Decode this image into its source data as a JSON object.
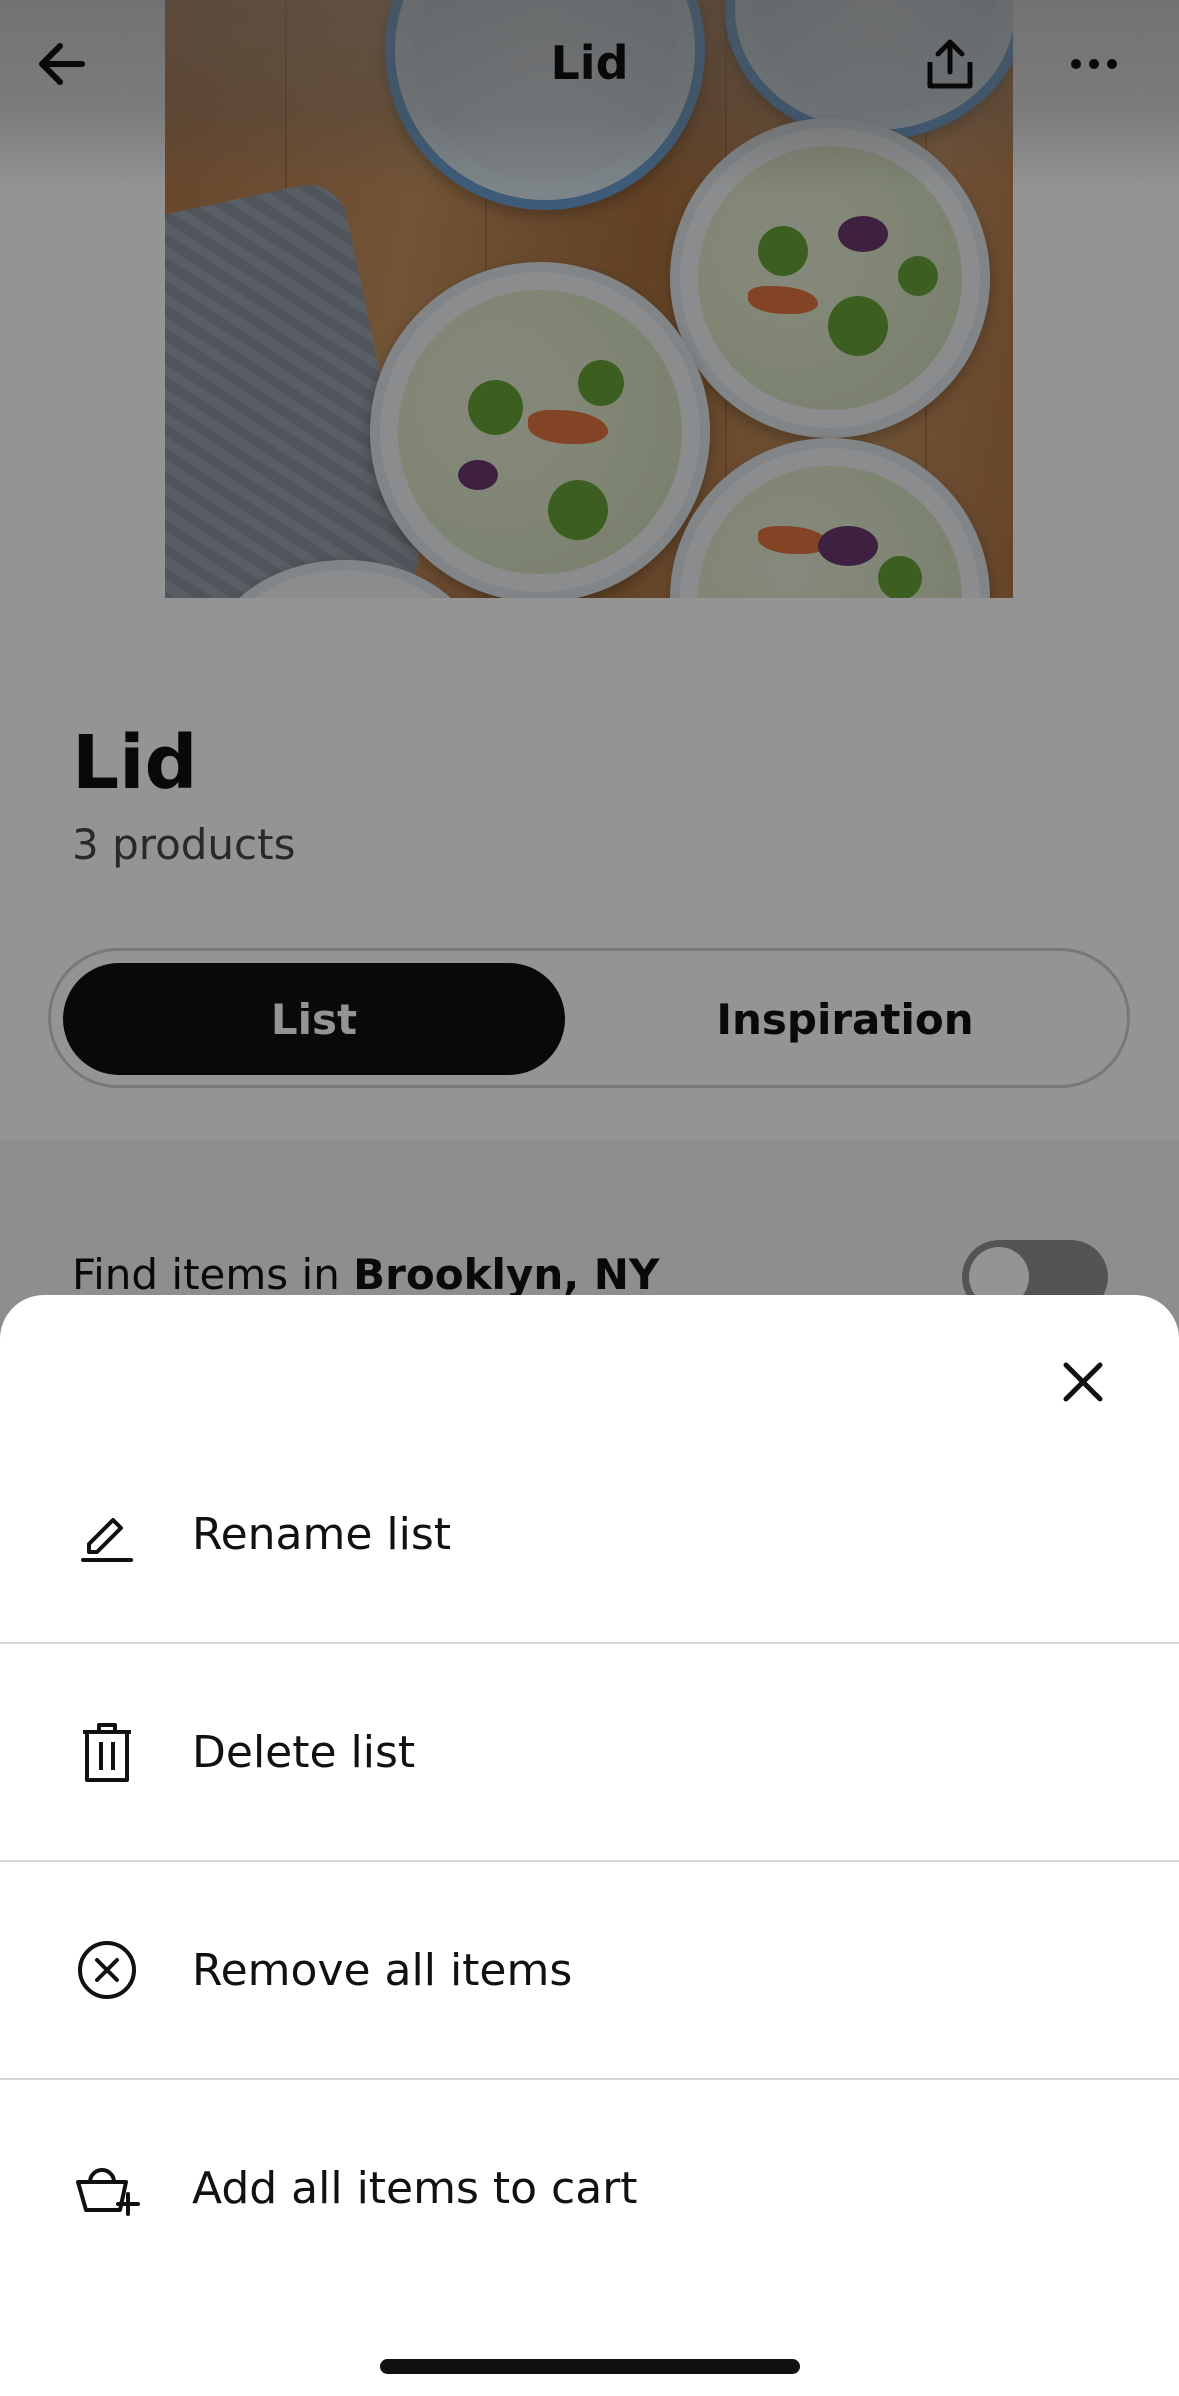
{
  "topbar": {
    "title": "Lid",
    "back_icon": "arrow-left-icon",
    "share_icon": "share-icon",
    "more_icon": "more-horizontal-icon"
  },
  "hero": {
    "image_icon": "food-containers-photo"
  },
  "list": {
    "title": "Lid",
    "count": "3 products"
  },
  "tabs": [
    {
      "label": "List",
      "selected": true
    },
    {
      "label": "Inspiration",
      "selected": false
    }
  ],
  "store": {
    "prefix": "Find items in ",
    "location": "Brooklyn, NY",
    "toggle_on": false
  },
  "sheet": {
    "close_icon": "close-icon",
    "items": [
      {
        "label": "Rename list",
        "icon": "pencil-icon"
      },
      {
        "label": "Delete list",
        "icon": "trash-icon"
      },
      {
        "label": "Remove all items",
        "icon": "circle-x-icon"
      },
      {
        "label": "Add all items to cart",
        "icon": "cart-add-icon"
      }
    ]
  },
  "colors": {
    "primary_dark": "#111111",
    "overlay": "rgba(0,0,0,0.42)",
    "divider": "#d6d6d6"
  }
}
